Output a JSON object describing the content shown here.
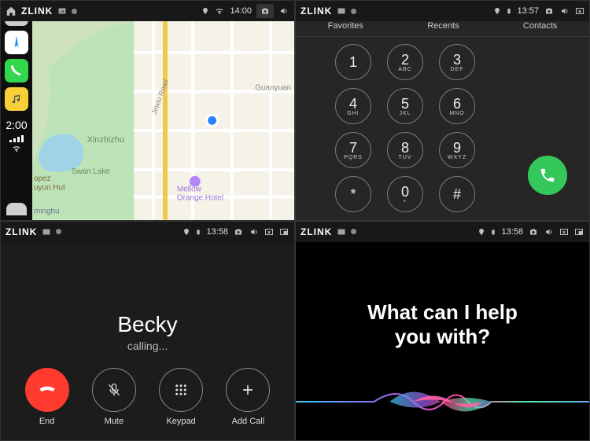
{
  "statusbar": {
    "title": "ZLINK",
    "time_a": "14:00",
    "time_b": "13:57",
    "time_c": "13:58",
    "time_d": "13:58"
  },
  "map": {
    "side_time": "2:00",
    "labels": {
      "xinzhizhu": "Xinzhizhu",
      "swan": "Swan Lake",
      "jinxiu": "Jinxiu Road",
      "guanyuan": "Guanyuan",
      "opez": "opez",
      "uyun": "uyun Hut",
      "minghu": "minghu",
      "mellow": "Mellow Orange Hotel"
    }
  },
  "dialer": {
    "tabs": {
      "fav": "Favorites",
      "rec": "Recents",
      "con": "Contacts"
    },
    "keys": [
      {
        "n": "1",
        "s": ""
      },
      {
        "n": "2",
        "s": "ABC"
      },
      {
        "n": "3",
        "s": "DEF"
      },
      {
        "n": "4",
        "s": "GHI"
      },
      {
        "n": "5",
        "s": "JKL"
      },
      {
        "n": "6",
        "s": "MNO"
      },
      {
        "n": "7",
        "s": "PQRS"
      },
      {
        "n": "8",
        "s": "TUV"
      },
      {
        "n": "9",
        "s": "WXYZ"
      },
      {
        "n": "*",
        "s": ""
      },
      {
        "n": "0",
        "s": "+"
      },
      {
        "n": "#",
        "s": ""
      }
    ]
  },
  "call": {
    "name": "Becky",
    "status": "calling...",
    "actions": {
      "end": "End",
      "mute": "Mute",
      "keypad": "Keypad",
      "add": "Add Call"
    }
  },
  "siri": {
    "prompt_l1": "What can I help",
    "prompt_l2": "you with?"
  }
}
